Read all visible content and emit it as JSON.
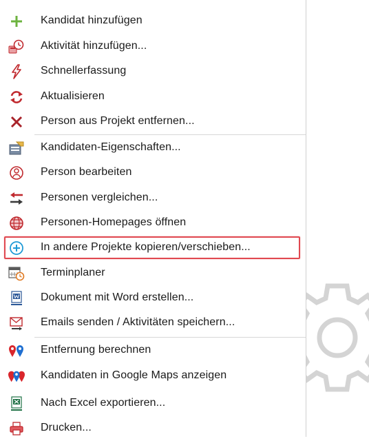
{
  "menu": {
    "items": [
      {
        "icon": "plus-icon",
        "label": "Kandidat hinzufügen"
      },
      {
        "icon": "activity-clock-icon",
        "label": "Aktivität hinzufügen..."
      },
      {
        "icon": "lightning-icon",
        "label": "Schnellerfassung"
      },
      {
        "icon": "refresh-icon",
        "label": "Aktualisieren"
      },
      {
        "icon": "remove-x-icon",
        "label": "Person aus Projekt entfernen..."
      },
      {
        "icon": "properties-icon",
        "label": "Kandidaten-Eigenschaften..."
      },
      {
        "icon": "person-edit-icon",
        "label": "Person bearbeiten"
      },
      {
        "icon": "compare-arrows-icon",
        "label": "Personen vergleichen..."
      },
      {
        "icon": "globe-icon",
        "label": "Personen-Homepages öffnen"
      },
      {
        "icon": "circle-plus-icon",
        "label": "In andere Projekte kopieren/verschieben..."
      },
      {
        "icon": "calendar-clock-icon",
        "label": "Terminplaner"
      },
      {
        "icon": "word-document-icon",
        "label": "Dokument mit Word erstellen..."
      },
      {
        "icon": "email-icon",
        "label": "Emails senden / Aktivitäten speichern..."
      },
      {
        "icon": "map-pins-icon",
        "label": "Entfernung berechnen"
      },
      {
        "icon": "map-pins-multi-icon",
        "label": "Kandidaten in Google Maps anzeigen"
      },
      {
        "icon": "excel-icon",
        "label": "Nach Excel exportieren..."
      },
      {
        "icon": "printer-icon",
        "label": "Drucken..."
      }
    ],
    "highlighted_index": 9
  },
  "colors": {
    "highlight_border": "#e0484f",
    "plus_green": "#6cb33f",
    "accent_red": "#c0292e",
    "accent_blue": "#1f9ad6"
  }
}
